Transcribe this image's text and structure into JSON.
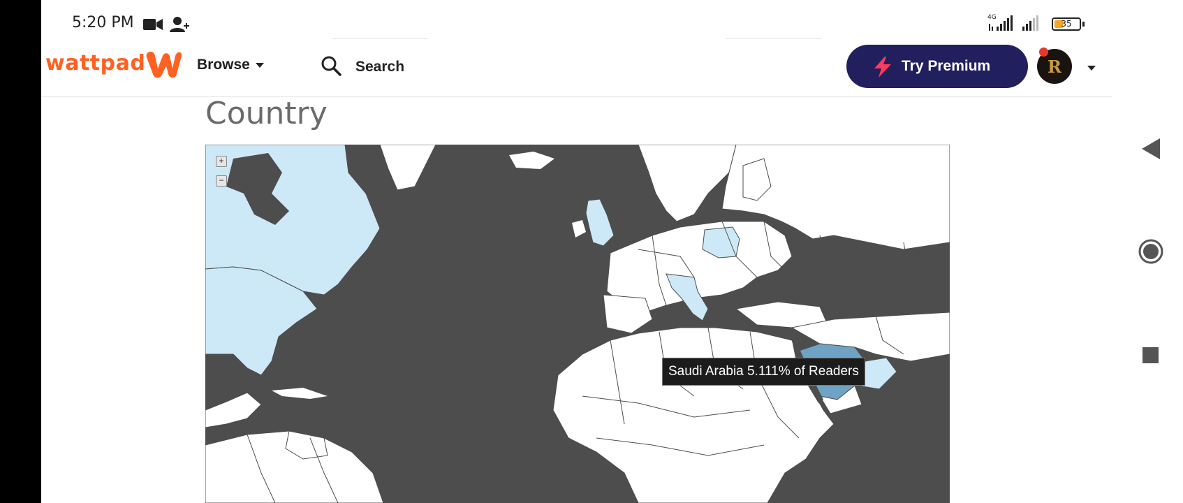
{
  "status_bar": {
    "time": "5:20 PM",
    "network": "4G",
    "battery": "35",
    "battery_level": 0.35,
    "icons": [
      "video-camera-icon",
      "add-person-icon",
      "signal-icon",
      "battery-icon"
    ]
  },
  "header": {
    "logo": "wattpad",
    "browse_label": "Browse",
    "search_label": "Search",
    "premium_label": "Try Premium",
    "avatar_letter": "R"
  },
  "main": {
    "section_title": "Country",
    "map": {
      "zoom_in": "+",
      "zoom_out": "−",
      "tooltip": "Saudi Arabia 5.111% of Readers",
      "colors": {
        "ocean": "#4d4d4d",
        "land": "#ffffff",
        "low_readers": "#cde9f8",
        "highlighted": "#6fa3c5"
      }
    }
  },
  "navbar": {
    "icons": [
      "back-icon",
      "home-icon",
      "recents-icon"
    ]
  },
  "colors": {
    "brand": "#ff6122",
    "premium_bg": "#221f5e",
    "premium_bolt": "#ff3b5c"
  }
}
